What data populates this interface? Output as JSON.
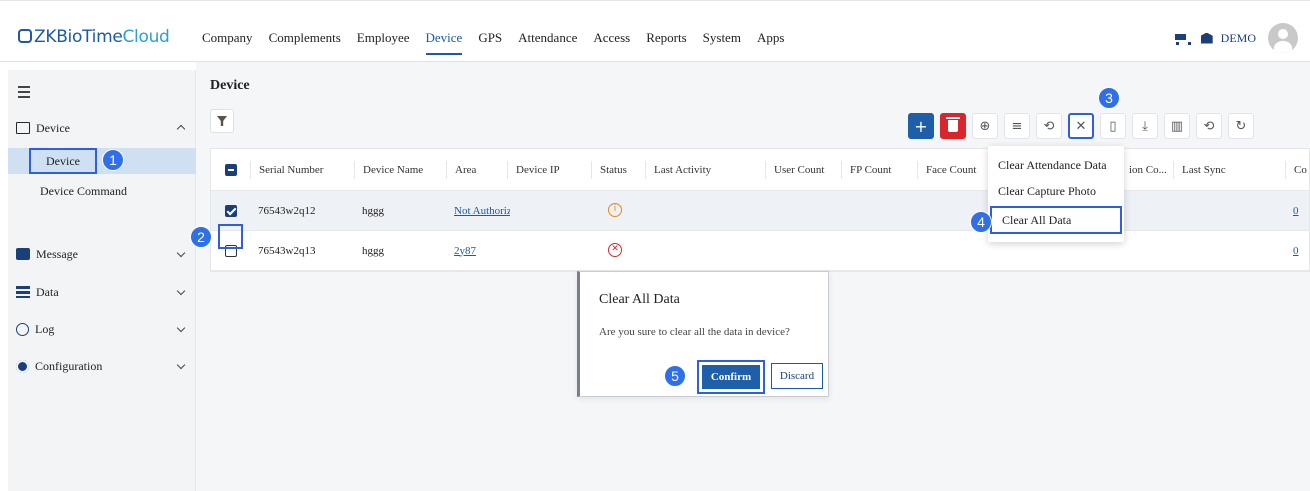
{
  "app": {
    "logo_main": "ZKBioTime",
    "logo_accent": "Cloud"
  },
  "nav": [
    "Company",
    "Complements",
    "Employee",
    "Device",
    "GPS",
    "Attendance",
    "Access",
    "Reports",
    "System",
    "Apps"
  ],
  "nav_active": "Device",
  "user": {
    "name": "DEMO"
  },
  "sidebar": {
    "items": [
      {
        "label": "Device",
        "icon": "device-icon",
        "expanded": true
      },
      {
        "label": "Message",
        "icon": "message-icon"
      },
      {
        "label": "Data",
        "icon": "data-icon"
      },
      {
        "label": "Log",
        "icon": "log-icon"
      },
      {
        "label": "Configuration",
        "icon": "gear-icon"
      }
    ],
    "sub_items": [
      "Device",
      "Device Command"
    ],
    "active_sub": "Device"
  },
  "page": {
    "title": "Device"
  },
  "toolbar": [
    "add-icon",
    "delete-icon",
    "location-icon",
    "list-icon",
    "user-sync-icon",
    "clear-icon",
    "device-icon",
    "download-icon",
    "columns-icon",
    "history-icon",
    "refresh-icon"
  ],
  "table": {
    "columns": [
      "Serial Number",
      "Device Name",
      "Area",
      "Device IP",
      "Status",
      "Last Activity",
      "User Count",
      "FP Count",
      "Face Count",
      "ion Co...",
      "Last Sync",
      "Co"
    ],
    "rows": [
      {
        "serial": "76543w2q12",
        "name": "hggg",
        "area": "Not Authoriz",
        "status": "warning",
        "checked": true,
        "last_col": "0"
      },
      {
        "serial": "76543w2q13",
        "name": "hggg",
        "area": "2y87",
        "status": "error",
        "checked": false,
        "last_col": "0"
      }
    ]
  },
  "dropdown": {
    "items": [
      "Clear Attendance Data",
      "Clear Capture Photo",
      "Clear All Data"
    ]
  },
  "modal": {
    "title": "Clear All Data",
    "message": "Are you sure to clear all the data in device?",
    "confirm": "Confirm",
    "discard": "Discard"
  },
  "steps": [
    "1",
    "2",
    "3",
    "4",
    "5"
  ],
  "colors": {
    "primary": "#1f5ea8",
    "danger": "#d9262d",
    "step": "#2f6fe8",
    "highlight": "#2f5fe0"
  }
}
